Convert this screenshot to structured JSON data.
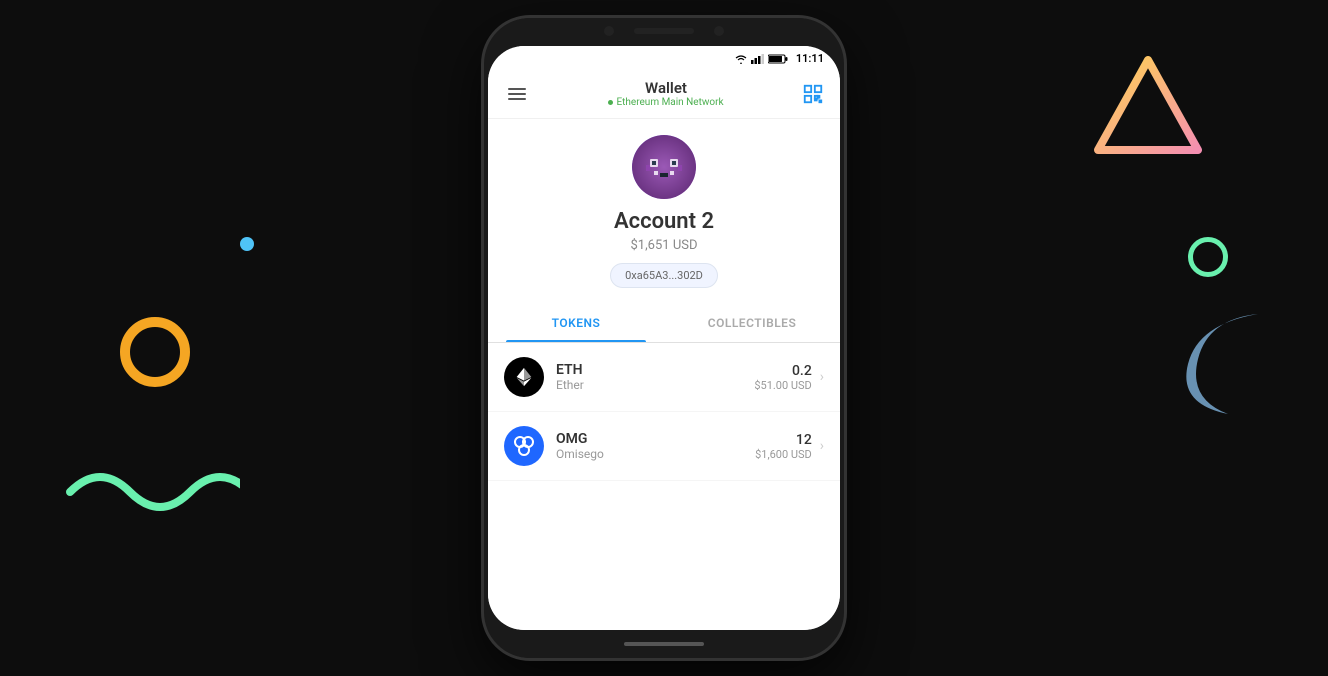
{
  "background": {
    "color": "#0d0d0d"
  },
  "phone": {
    "status_bar": {
      "time": "11:11"
    },
    "header": {
      "title": "Wallet",
      "network": "Ethereum Main Network",
      "network_dot_color": "#4CAF50"
    },
    "account": {
      "name": "Account 2",
      "balance": "$1,651 USD",
      "address": "0xa65A3...302D"
    },
    "tabs": [
      {
        "label": "TOKENS",
        "active": true
      },
      {
        "label": "COLLECTIBLES",
        "active": false
      }
    ],
    "tokens": [
      {
        "symbol": "ETH",
        "name": "Ether",
        "amount": "0.2",
        "usd": "$51.00 USD",
        "icon_type": "eth"
      },
      {
        "symbol": "OMG",
        "name": "Omisego",
        "amount": "12",
        "usd": "$1,600 USD",
        "icon_type": "omg"
      }
    ]
  },
  "decorative": {
    "yellow_circle": true,
    "blue_dot": true,
    "green_wave": true,
    "green_circle": true,
    "blue_crescent": true,
    "triangle": true
  }
}
